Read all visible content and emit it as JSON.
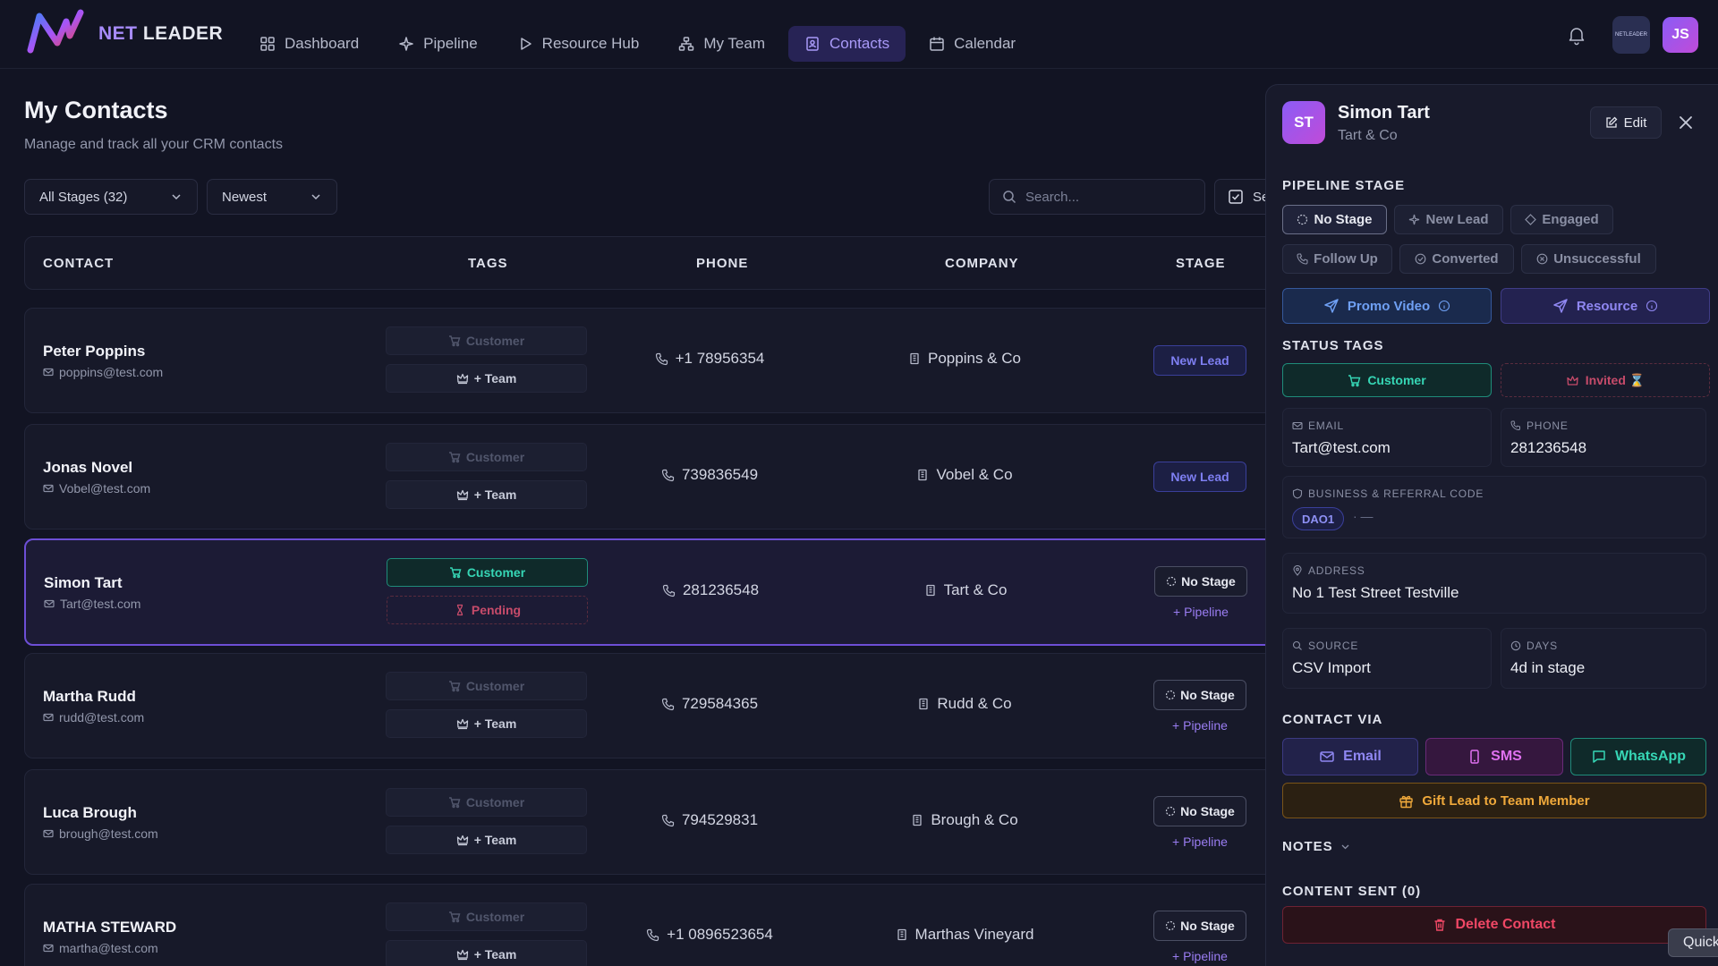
{
  "app": {
    "logo_net": "NET",
    "logo_leader": "LEADER"
  },
  "nav": [
    {
      "label": "Dashboard",
      "icon": "grid-icon"
    },
    {
      "label": "Pipeline",
      "icon": "sparkle-icon"
    },
    {
      "label": "Resource Hub",
      "icon": "play-icon"
    },
    {
      "label": "My Team",
      "icon": "team-icon"
    },
    {
      "label": "Contacts",
      "icon": "contact-book-icon",
      "active": true
    },
    {
      "label": "Calendar",
      "icon": "calendar-icon"
    }
  ],
  "topbar": {
    "user_initials": "JS",
    "org_badge": "NETLEADER"
  },
  "page": {
    "title": "My Contacts",
    "subtitle": "Manage and track all your CRM contacts"
  },
  "filters": {
    "stage_select": "All Stages (32)",
    "sort_select": "Newest",
    "search_placeholder": "Search...",
    "select_label": "Se"
  },
  "table": {
    "headers": [
      "CONTACT",
      "TAGS",
      "PHONE",
      "COMPANY",
      "STAGE"
    ],
    "rows": [
      {
        "name": "Peter Poppins",
        "email": "poppins@test.com",
        "tag1": "Customer",
        "tag2": "+ Team",
        "phone": "+1 78956354",
        "company": "Poppins & Co",
        "stage": "New Lead",
        "pipeline": ""
      },
      {
        "name": "Jonas Novel",
        "email": "Vobel@test.com",
        "tag1": "Customer",
        "tag2": "+ Team",
        "phone": "739836549",
        "company": "Vobel & Co",
        "stage": "New Lead",
        "pipeline": ""
      },
      {
        "name": "Simon Tart",
        "email": "Tart@test.com",
        "tag1": "Customer",
        "tag2": "Pending",
        "phone": "281236548",
        "company": "Tart & Co",
        "stage": "No Stage",
        "pipeline": "+ Pipeline"
      },
      {
        "name": "Martha Rudd",
        "email": "rudd@test.com",
        "tag1": "Customer",
        "tag2": "+ Team",
        "phone": "729584365",
        "company": "Rudd & Co",
        "stage": "No Stage",
        "pipeline": "+ Pipeline"
      },
      {
        "name": "Luca Brough",
        "email": "brough@test.com",
        "tag1": "Customer",
        "tag2": "+ Team",
        "phone": "794529831",
        "company": "Brough & Co",
        "stage": "No Stage",
        "pipeline": "+ Pipeline"
      },
      {
        "name": "MATHA STEWARD",
        "email": "martha@test.com",
        "tag1": "Customer",
        "tag2": "+ Team",
        "phone": "+1 0896523654",
        "company": "Marthas Vineyard",
        "stage": "No Stage",
        "pipeline": "+ Pipeline"
      }
    ]
  },
  "panel": {
    "initials": "ST",
    "name": "Simon Tart",
    "company": "Tart & Co",
    "edit_label": "Edit",
    "pipeline_stage_title": "PIPELINE STAGE",
    "stages": [
      "No Stage",
      "New Lead",
      "Engaged",
      "Follow Up",
      "Converted",
      "Unsuccessful"
    ],
    "active_stage": "No Stage",
    "promo_label": "Promo Video",
    "resource_label": "Resource",
    "status_tags_title": "STATUS TAGS",
    "tag_customer": "Customer",
    "tag_invited": "Invited ⌛",
    "email_label": "EMAIL",
    "email_value": "Tart@test.com",
    "phone_label": "PHONE",
    "phone_value": "281236548",
    "business_label": "BUSINESS & REFERRAL CODE",
    "business_code": "DAO1",
    "business_sep": "· —",
    "address_label": "ADDRESS",
    "address_value": "No 1 Test Street Testville",
    "source_label": "SOURCE",
    "source_value": "CSV Import",
    "days_label": "DAYS",
    "days_value": "4d in stage",
    "contact_via_title": "CONTACT VIA",
    "via_email": "Email",
    "via_sms": "SMS",
    "via_whatsapp": "WhatsApp",
    "gift_label": "Gift Lead to Team Member",
    "notes_title": "NOTES",
    "content_sent_title": "CONTENT SENT (0)",
    "delete_label": "Delete Contact",
    "quick_label": "Quick"
  },
  "colors": {
    "accent": "#8b5cf6",
    "customer": "#36d6b5",
    "pending": "#c64b6a",
    "delete": "#ef4765",
    "gift": "#f0a93b"
  }
}
